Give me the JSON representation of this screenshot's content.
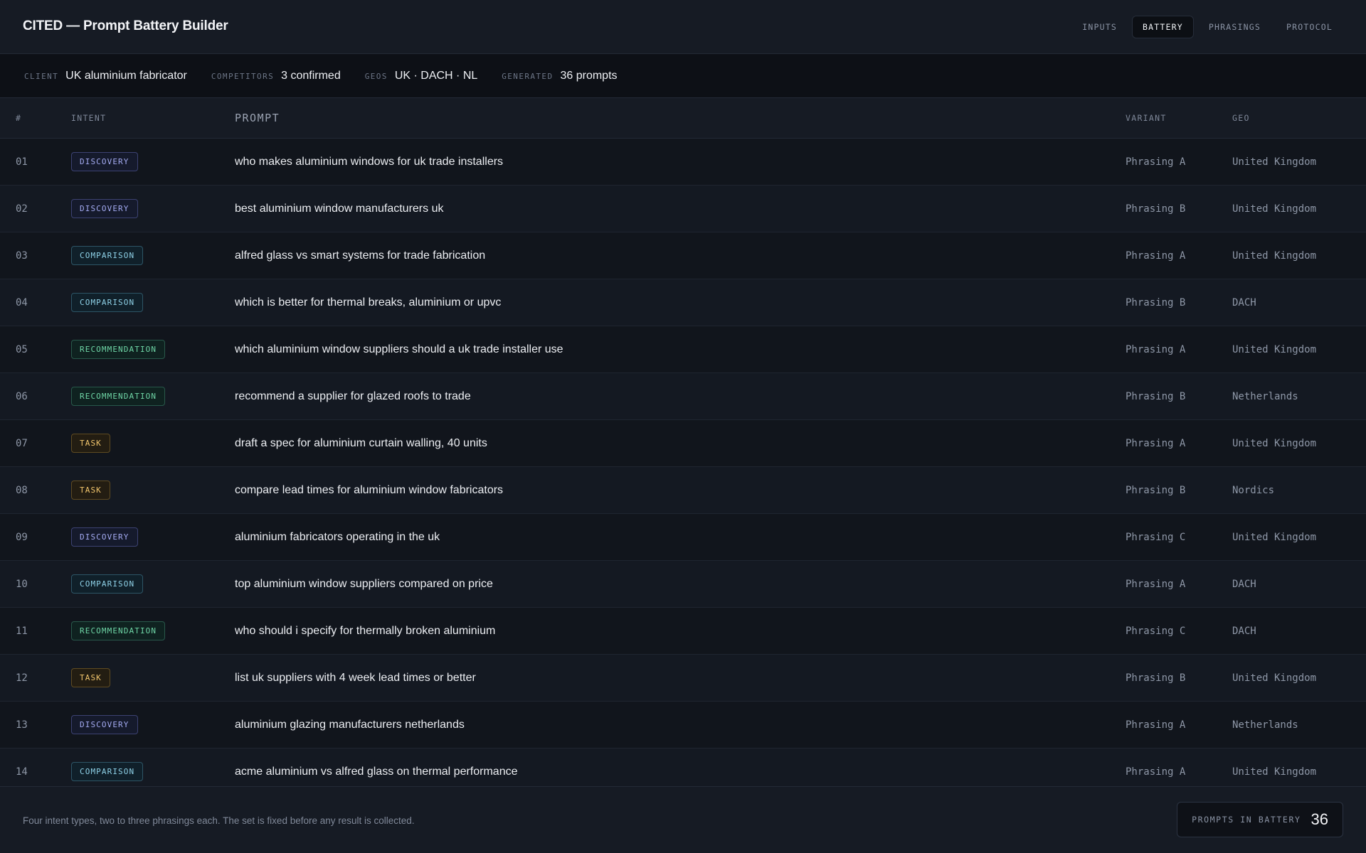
{
  "app": {
    "title": "CITED — Prompt Battery Builder"
  },
  "tabs": [
    {
      "label": "INPUTS",
      "active": false
    },
    {
      "label": "BATTERY",
      "active": true
    },
    {
      "label": "PHRASINGS",
      "active": false
    },
    {
      "label": "PROTOCOL",
      "active": false
    }
  ],
  "meta": {
    "client_label": "CLIENT",
    "client_value": "UK aluminium fabricator",
    "competitors_label": "COMPETITORS",
    "competitors_value": "3 confirmed",
    "geos_label": "GEOS",
    "geos_value": "UK · DACH · NL",
    "generated_label": "GENERATED",
    "generated_value": "36 prompts"
  },
  "table": {
    "headers": {
      "num": "#",
      "intent": "INTENT",
      "prompt": "PROMPT",
      "variant": "VARIANT",
      "geo": "GEO"
    },
    "rows": [
      {
        "num": "01",
        "intent": "DISCOVERY",
        "prompt": "who makes aluminium windows for uk trade installers",
        "variant": "Phrasing A",
        "geo": "United Kingdom"
      },
      {
        "num": "02",
        "intent": "DISCOVERY",
        "prompt": "best aluminium window manufacturers uk",
        "variant": "Phrasing B",
        "geo": "United Kingdom"
      },
      {
        "num": "03",
        "intent": "COMPARISON",
        "prompt": "alfred glass vs smart systems for trade fabrication",
        "variant": "Phrasing A",
        "geo": "United Kingdom"
      },
      {
        "num": "04",
        "intent": "COMPARISON",
        "prompt": "which is better for thermal breaks, aluminium or upvc",
        "variant": "Phrasing B",
        "geo": "DACH"
      },
      {
        "num": "05",
        "intent": "RECOMMENDATION",
        "prompt": "which aluminium window suppliers should a uk trade installer use",
        "variant": "Phrasing A",
        "geo": "United Kingdom"
      },
      {
        "num": "06",
        "intent": "RECOMMENDATION",
        "prompt": "recommend a supplier for glazed roofs to trade",
        "variant": "Phrasing B",
        "geo": "Netherlands"
      },
      {
        "num": "07",
        "intent": "TASK",
        "prompt": "draft a spec for aluminium curtain walling, 40 units",
        "variant": "Phrasing A",
        "geo": "United Kingdom"
      },
      {
        "num": "08",
        "intent": "TASK",
        "prompt": "compare lead times for aluminium window fabricators",
        "variant": "Phrasing B",
        "geo": "Nordics"
      },
      {
        "num": "09",
        "intent": "DISCOVERY",
        "prompt": "aluminium fabricators operating in the uk",
        "variant": "Phrasing C",
        "geo": "United Kingdom"
      },
      {
        "num": "10",
        "intent": "COMPARISON",
        "prompt": "top aluminium window suppliers compared on price",
        "variant": "Phrasing A",
        "geo": "DACH"
      },
      {
        "num": "11",
        "intent": "RECOMMENDATION",
        "prompt": "who should i specify for thermally broken aluminium",
        "variant": "Phrasing C",
        "geo": "DACH"
      },
      {
        "num": "12",
        "intent": "TASK",
        "prompt": "list uk suppliers with 4 week lead times or better",
        "variant": "Phrasing B",
        "geo": "United Kingdom"
      },
      {
        "num": "13",
        "intent": "DISCOVERY",
        "prompt": "aluminium glazing manufacturers netherlands",
        "variant": "Phrasing A",
        "geo": "Netherlands"
      },
      {
        "num": "14",
        "intent": "COMPARISON",
        "prompt": "acme aluminium vs alfred glass on thermal performance",
        "variant": "Phrasing A",
        "geo": "United Kingdom"
      }
    ]
  },
  "footer": {
    "note": "Four intent types, two to three phrasings each. The set is fixed before any result is collected.",
    "counter_label": "PROMPTS IN BATTERY",
    "counter_value": "36"
  }
}
